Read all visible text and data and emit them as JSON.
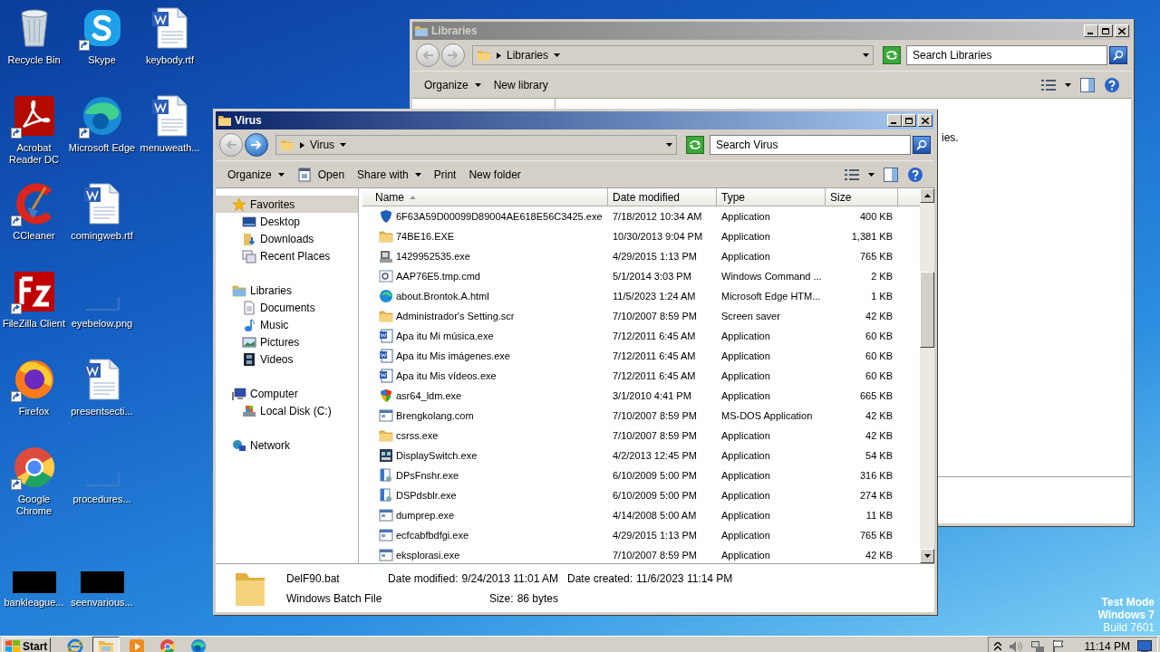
{
  "desktop": {
    "icons": [
      {
        "label": "Recycle Bin",
        "kind": "recycle",
        "shortcut": false
      },
      {
        "label": "Acrobat Reader DC",
        "kind": "acrobat",
        "shortcut": true
      },
      {
        "label": "CCleaner",
        "kind": "ccleaner",
        "shortcut": true
      },
      {
        "label": "FileZilla Client",
        "kind": "filezilla",
        "shortcut": true
      },
      {
        "label": "Firefox",
        "kind": "firefox",
        "shortcut": true
      },
      {
        "label": "Google Chrome",
        "kind": "chrome",
        "shortcut": true
      },
      {
        "label": "bankleague...",
        "kind": "black",
        "shortcut": false
      },
      {
        "label": "Skype",
        "kind": "skype",
        "shortcut": true
      },
      {
        "label": "Microsoft Edge",
        "kind": "edge",
        "shortcut": true
      },
      {
        "label": "comingweb.rtf",
        "kind": "word",
        "shortcut": false
      },
      {
        "label": "eyebelow.png",
        "kind": "image",
        "shortcut": false
      },
      {
        "label": "presentsecti...",
        "kind": "word",
        "shortcut": false
      },
      {
        "label": "procedures...",
        "kind": "image",
        "shortcut": false
      },
      {
        "label": "seenvarious...",
        "kind": "black",
        "shortcut": false
      },
      {
        "label": "keybody.rtf",
        "kind": "word",
        "shortcut": false
      },
      {
        "label": "menuweath...",
        "kind": "word",
        "shortcut": false
      }
    ],
    "os_notice": [
      "Test Mode",
      "Windows 7",
      "Build 7601"
    ]
  },
  "windows": [
    {
      "title": "Libraries",
      "active": false,
      "forward_enabled": false,
      "address": "Libraries",
      "search_placeholder": "Search Libraries",
      "toolbar": [
        {
          "label": "Organize",
          "kind": "menu"
        },
        {
          "label": "New library",
          "kind": "plain"
        }
      ],
      "body_text": "ies."
    },
    {
      "title": "Virus",
      "active": true,
      "forward_enabled": true,
      "address": "Virus",
      "search_placeholder": "Search Virus",
      "toolbar": [
        {
          "label": "Organize",
          "kind": "menu"
        },
        {
          "label": "Open",
          "kind": "icon"
        },
        {
          "label": "Share with",
          "kind": "menu"
        },
        {
          "label": "Print",
          "kind": "plain"
        },
        {
          "label": "New folder",
          "kind": "plain"
        }
      ],
      "nav_pane": [
        {
          "label": "Favorites",
          "kind": "favorites",
          "selected": true,
          "children": [
            {
              "label": "Desktop",
              "kind": "desktop",
              "selected": false
            },
            {
              "label": "Downloads",
              "kind": "downloads",
              "selected": false
            },
            {
              "label": "Recent Places",
              "kind": "recent",
              "selected": false
            }
          ]
        },
        {
          "label": "Libraries",
          "kind": "libraries",
          "selected": false,
          "children": [
            {
              "label": "Documents",
              "kind": "documents",
              "selected": false
            },
            {
              "label": "Music",
              "kind": "music",
              "selected": false
            },
            {
              "label": "Pictures",
              "kind": "pictures",
              "selected": false
            },
            {
              "label": "Videos",
              "kind": "videos",
              "selected": false
            }
          ]
        },
        {
          "label": "Computer",
          "kind": "computer",
          "selected": false,
          "children": [
            {
              "label": "Local Disk (C:)",
              "kind": "disk",
              "selected": false
            }
          ]
        },
        {
          "label": "Network",
          "kind": "network",
          "selected": false
        }
      ],
      "columns": [
        "Name",
        "Date modified",
        "Type",
        "Size"
      ],
      "rows": [
        {
          "name": "6F63A59D00099D89004AE618E56C3425.exe",
          "date": "7/18/2012 10:34 AM",
          "type": "Application",
          "size": "400 KB",
          "kind": "shield"
        },
        {
          "name": "74BE16.EXE",
          "date": "10/30/2013 9:04 PM",
          "type": "Application",
          "size": "1,381 KB",
          "kind": "folder"
        },
        {
          "name": "1429952535.exe",
          "date": "4/29/2015 1:13 PM",
          "type": "Application",
          "size": "765 KB",
          "kind": "installer"
        },
        {
          "name": "AAP76E5.tmp.cmd",
          "date": "5/1/2014 3:03 PM",
          "type": "Windows Command ...",
          "size": "2 KB",
          "kind": "script"
        },
        {
          "name": "about.Brontok.A.html",
          "date": "11/5/2023 1:24 AM",
          "type": "Microsoft Edge HTM...",
          "size": "1 KB",
          "kind": "web"
        },
        {
          "name": "Administrador's Setting.scr",
          "date": "7/10/2007 8:59 PM",
          "type": "Screen saver",
          "size": "42 KB",
          "kind": "folder"
        },
        {
          "name": "Apa itu Mi música.exe",
          "date": "7/12/2011 6:45 AM",
          "type": "Application",
          "size": "60 KB",
          "kind": "worddoc"
        },
        {
          "name": "Apa itu Mis imágenes.exe",
          "date": "7/12/2011 6:45 AM",
          "type": "Application",
          "size": "60 KB",
          "kind": "worddoc"
        },
        {
          "name": "Apa itu Mis vídeos.exe",
          "date": "7/12/2011 6:45 AM",
          "type": "Application",
          "size": "60 KB",
          "kind": "worddoc"
        },
        {
          "name": "asr64_ldm.exe",
          "date": "3/1/2010 4:41 PM",
          "type": "Application",
          "size": "665 KB",
          "kind": "security"
        },
        {
          "name": "Brengkolang.com",
          "date": "7/10/2007 8:59 PM",
          "type": "MS-DOS Application",
          "size": "42 KB",
          "kind": "window"
        },
        {
          "name": "csrss.exe",
          "date": "7/10/2007 8:59 PM",
          "type": "Application",
          "size": "42 KB",
          "kind": "folder"
        },
        {
          "name": "DisplaySwitch.exe",
          "date": "4/2/2013 12:45 PM",
          "type": "Application",
          "size": "54 KB",
          "kind": "display"
        },
        {
          "name": "DPsFnshr.exe",
          "date": "6/10/2009 5:00 PM",
          "type": "Application",
          "size": "316 KB",
          "kind": "setupdoc"
        },
        {
          "name": "DSPdsblr.exe",
          "date": "6/10/2009 5:00 PM",
          "type": "Application",
          "size": "274 KB",
          "kind": "setupdoc"
        },
        {
          "name": "dumprep.exe",
          "date": "4/14/2008 5:00 AM",
          "type": "Application",
          "size": "11 KB",
          "kind": "window"
        },
        {
          "name": "ecfcabfbdfgi.exe",
          "date": "4/29/2015 1:13 PM",
          "type": "Application",
          "size": "765 KB",
          "kind": "window"
        },
        {
          "name": "eksplorasi.exe",
          "date": "7/10/2007 8:59 PM",
          "type": "Application",
          "size": "42 KB",
          "kind": "window"
        }
      ],
      "details": {
        "name": "DelF90.bat",
        "file_type": "Windows Batch File",
        "fields": [
          {
            "label": "Date modified:",
            "value": "9/24/2013 11:01 AM"
          },
          {
            "label": "Size:",
            "value": "86 bytes"
          },
          {
            "label": "Date created:",
            "value": "11/6/2023 11:14 PM"
          }
        ]
      }
    }
  ],
  "taskbar": {
    "start": "Start",
    "apps": [
      {
        "kind": "ie",
        "selected": false
      },
      {
        "kind": "explorer",
        "selected": true
      },
      {
        "kind": "media",
        "selected": false
      },
      {
        "kind": "chrome",
        "selected": false
      },
      {
        "kind": "edge",
        "selected": false
      }
    ],
    "clock": "11:14 PM"
  }
}
